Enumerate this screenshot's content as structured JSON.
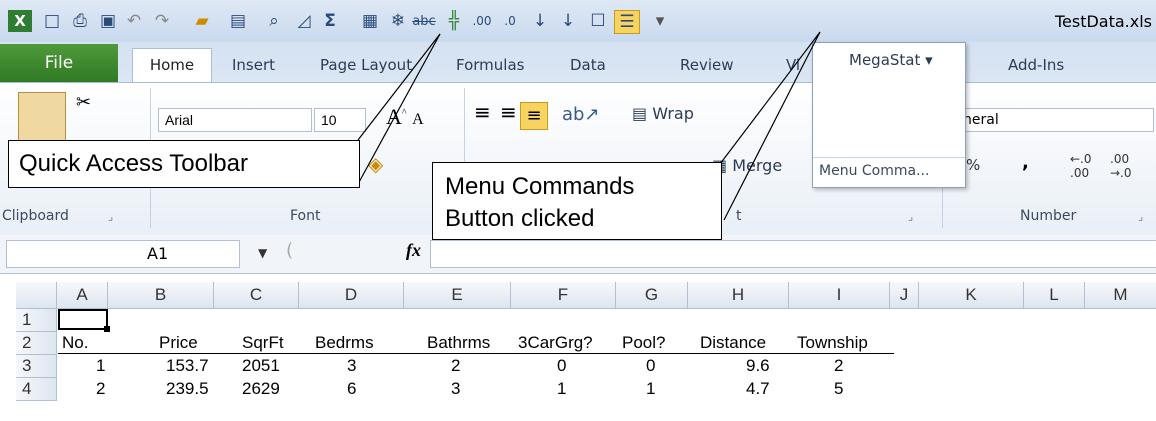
{
  "window": {
    "title": "TestData.xls"
  },
  "tabs": {
    "file": "File",
    "home": "Home",
    "insert": "Insert",
    "page_layout": "Page Layout",
    "formulas": "Formulas",
    "data": "Data",
    "review": "Review",
    "view_partial": "Vi",
    "megastat": "MegaStat ▾",
    "addins": "Add-Ins"
  },
  "ribbon": {
    "font_name": "Arial",
    "font_size": "10",
    "wrap_label": "Wrap",
    "merge_label": "Merge",
    "number_format": "neral",
    "percent": "%",
    "comma": ",",
    "groups": {
      "clipboard": "Clipboard",
      "font": "Font",
      "alignment": "t",
      "number": "Number"
    }
  },
  "popup": {
    "item": "Menu Comma..."
  },
  "formula_bar": {
    "name_box": "A1",
    "fx": "fx",
    "content": ""
  },
  "grid": {
    "columns": [
      "A",
      "B",
      "C",
      "D",
      "E",
      "F",
      "G",
      "H",
      "I",
      "J",
      "K",
      "L",
      "M"
    ],
    "rows": [
      "1",
      "2",
      "3",
      "4"
    ],
    "headers": [
      "No.",
      "Price",
      "SqrFt",
      "Bedrms",
      "Bathrms",
      "3CarGrg?",
      "Pool?",
      "Distance",
      "Township"
    ],
    "data": [
      [
        "1",
        "153.7",
        "2051",
        "3",
        "2",
        "0",
        "0",
        "9.6",
        "2"
      ],
      [
        "2",
        "239.5",
        "2629",
        "6",
        "3",
        "1",
        "1",
        "4.7",
        "5"
      ]
    ]
  },
  "callouts": {
    "qat": "Quick Access Toolbar",
    "menu_line1": "Menu Commands",
    "menu_line2": "Button clicked"
  },
  "colors": {
    "file_tab": "#2f7a24",
    "title_bar": "#dfe9f5",
    "highlight": "#f7d460"
  }
}
